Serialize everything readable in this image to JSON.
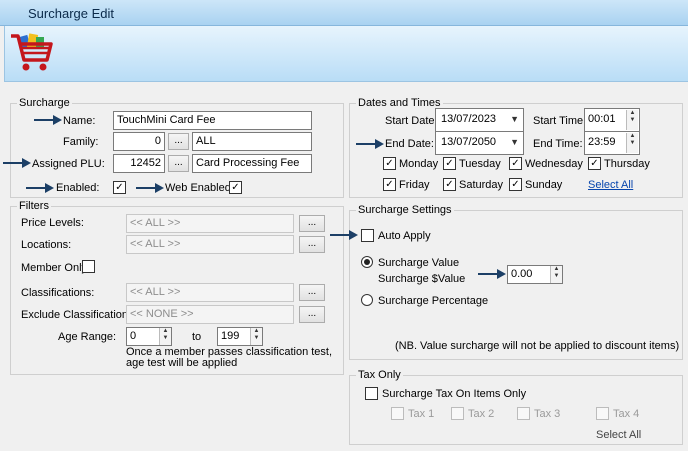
{
  "window": {
    "title": "Surcharge Edit"
  },
  "surcharge": {
    "legend": "Surcharge",
    "name_label": "Name:",
    "name_value": "TouchMini Card Fee",
    "family_label": "Family:",
    "family_code": "0",
    "family_name": "ALL",
    "plu_label": "Assigned PLU:",
    "plu_code": "12452",
    "plu_name": "Card Processing Fee",
    "browse_label": "...",
    "enabled_label": "Enabled:",
    "web_enabled_label": "Web Enabled",
    "check_mark": "✓"
  },
  "dates": {
    "legend": "Dates and Times",
    "start_date_label": "Start Date:",
    "start_date": "13/07/2023",
    "start_time_label": "Start Time:",
    "start_time": "00:01",
    "end_date_label": "End Date:",
    "end_date": "13/07/2050",
    "end_time_label": "End Time:",
    "end_time": "23:59",
    "days": [
      "Monday",
      "Tuesday",
      "Wednesday",
      "Thursday",
      "Friday",
      "Saturday",
      "Sunday"
    ],
    "select_all": "Select All"
  },
  "filters": {
    "legend": "Filters",
    "price_levels_label": "Price Levels:",
    "price_levels_value": "<< ALL >>",
    "locations_label": "Locations:",
    "locations_value": "<< ALL >>",
    "member_only_label": "Member Only",
    "classifications_label": "Classifications:",
    "classifications_value": "<< ALL >>",
    "exclude_label": "Exclude Classifications:",
    "exclude_value": "<< NONE >>",
    "age_range_label": "Age Range:",
    "age_from": "0",
    "age_to_label": "to",
    "age_to": "199",
    "age_note_1": "Once a member passes classification test,",
    "age_note_2": "age test will be applied"
  },
  "settings": {
    "legend": "Surcharge Settings",
    "auto_apply_label": "Auto Apply",
    "value_label": "Surcharge Value",
    "dollar_label": "Surcharge $Value",
    "dollar_value": "0.00",
    "percentage_label": "Surcharge Percentage",
    "note": "(NB. Value surcharge will not be applied to discount items)"
  },
  "tax": {
    "legend": "Tax Only",
    "tax_on_items_label": "Surcharge Tax On Items Only",
    "tax_labels": [
      "Tax 1",
      "Tax 2",
      "Tax 3",
      "Tax 4"
    ],
    "select_all": "Select All"
  },
  "colors": {
    "highlight": "#1c8a1c",
    "arrow": "#1c3f66",
    "link": "#0645ad"
  }
}
